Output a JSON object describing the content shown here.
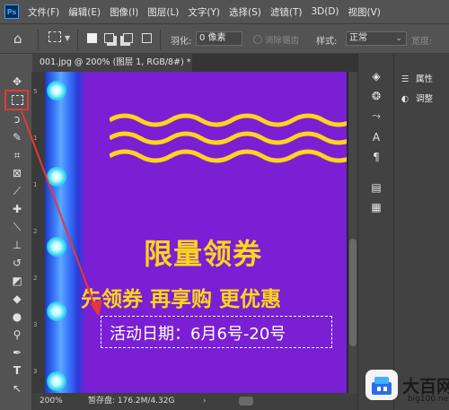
{
  "menubar": {
    "app_icon": "Ps",
    "items": [
      "文件(F)",
      "编辑(E)",
      "图像(I)",
      "图层(L)",
      "文字(Y)",
      "选择(S)",
      "滤镜(T)",
      "3D(D)",
      "视图(V)"
    ]
  },
  "options": {
    "feather_label": "羽化:",
    "feather_value": "0 像素",
    "antialias_label": "消除锯齿",
    "style_label": "样式:",
    "style_value": "正常",
    "width_label": "宽度:"
  },
  "document": {
    "tab_title": "001.jpg @ 200% (图层 1, RGB/8#) *",
    "tab_close": "×",
    "ruler_ticks": [
      "5",
      "1",
      "1",
      "2",
      "2",
      "3",
      "3"
    ]
  },
  "canvas": {
    "headline": "限量领券",
    "subline": "先领券 再享购 更优惠",
    "date_text": "活动日期：6月6号-20号"
  },
  "status": {
    "zoom": "200%",
    "scratch": "暂存盘: 176.2M/4.32G",
    "arrow": "›"
  },
  "panels": {
    "properties": "属性",
    "adjustments": "调整"
  },
  "watermark": {
    "logo_text": "大百网",
    "url": "big100.net"
  },
  "colors": {
    "canvas_bg": "#7a1fd4",
    "headline": "#ffd51c",
    "highlight": "#e53935"
  },
  "icons": {
    "toolbar": [
      "move-icon",
      "rectangular-marquee-icon",
      "lasso-icon",
      "quick-selection-icon",
      "crop-icon",
      "frame-icon",
      "eyedropper-icon",
      "healing-brush-icon",
      "brush-icon",
      "clone-stamp-icon",
      "history-brush-icon",
      "eraser-icon",
      "paint-bucket-icon",
      "blur-icon",
      "dodge-icon",
      "pen-icon",
      "type-icon",
      "path-selection-icon"
    ],
    "panel_strip": [
      "layers-icon",
      "channels-icon",
      "paths-icon",
      "character-icon",
      "paragraph-icon",
      "libraries-icon",
      "notes-icon"
    ]
  }
}
